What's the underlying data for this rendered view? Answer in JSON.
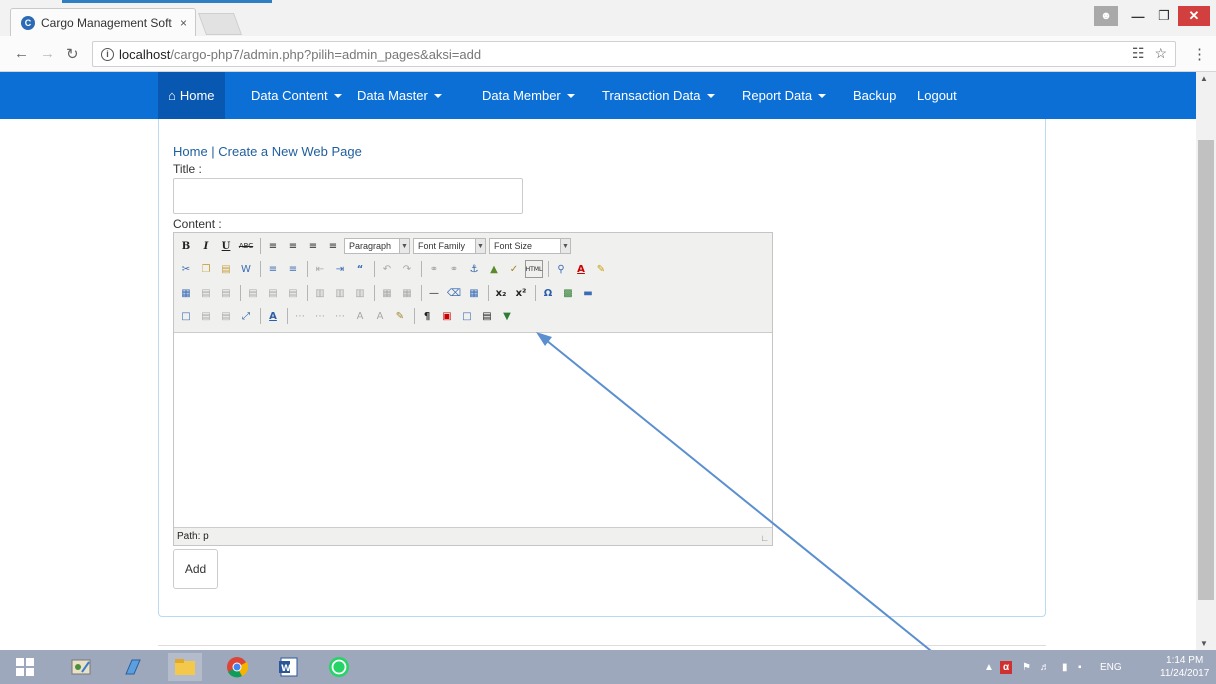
{
  "browser": {
    "tab_title": "Cargo Management Soft",
    "tab_close": "×",
    "url_host": "localhost",
    "url_path": "/cargo-php7/admin.php?pilih=admin_pages&aksi=add",
    "icons": [
      "back-icon",
      "forward-icon",
      "reload-icon",
      "info-icon",
      "translate-icon",
      "star-icon",
      "menu-icon"
    ]
  },
  "nav": {
    "items": [
      {
        "label": "Home",
        "icon": "home-icon",
        "active": true,
        "dropdown": false
      },
      {
        "label": "Data Content",
        "dropdown": true
      },
      {
        "label": "Data Master",
        "dropdown": true
      },
      {
        "label": "Data Member",
        "dropdown": true
      },
      {
        "label": "Transaction Data",
        "dropdown": true
      },
      {
        "label": "Report Data",
        "dropdown": true
      },
      {
        "label": "Backup",
        "dropdown": false
      },
      {
        "label": "Logout",
        "dropdown": false
      }
    ],
    "color": "#0b6fd6"
  },
  "page": {
    "breadcrumb_home": "Home",
    "breadcrumb_sep": " | ",
    "breadcrumb_current": "Create a New Web Page",
    "title_label": "Title :",
    "title_value": "",
    "content_label": "Content :",
    "add_button": "Add"
  },
  "editor": {
    "format_select": "Paragraph",
    "font_family_select": "Font Family",
    "font_size_select": "Font Size",
    "status_path": "Path: p"
  },
  "taskbar": {
    "apps": [
      "windows-start-icon",
      "paint-icon",
      "notepad-icon",
      "file-explorer-icon",
      "chrome-icon",
      "word-icon",
      "whatsapp-icon"
    ],
    "tray_lang": "ENG",
    "time": "1:14 PM",
    "date": "11/24/2017"
  },
  "annotation": {
    "type": "arrow",
    "color": "#5b8fd0"
  }
}
